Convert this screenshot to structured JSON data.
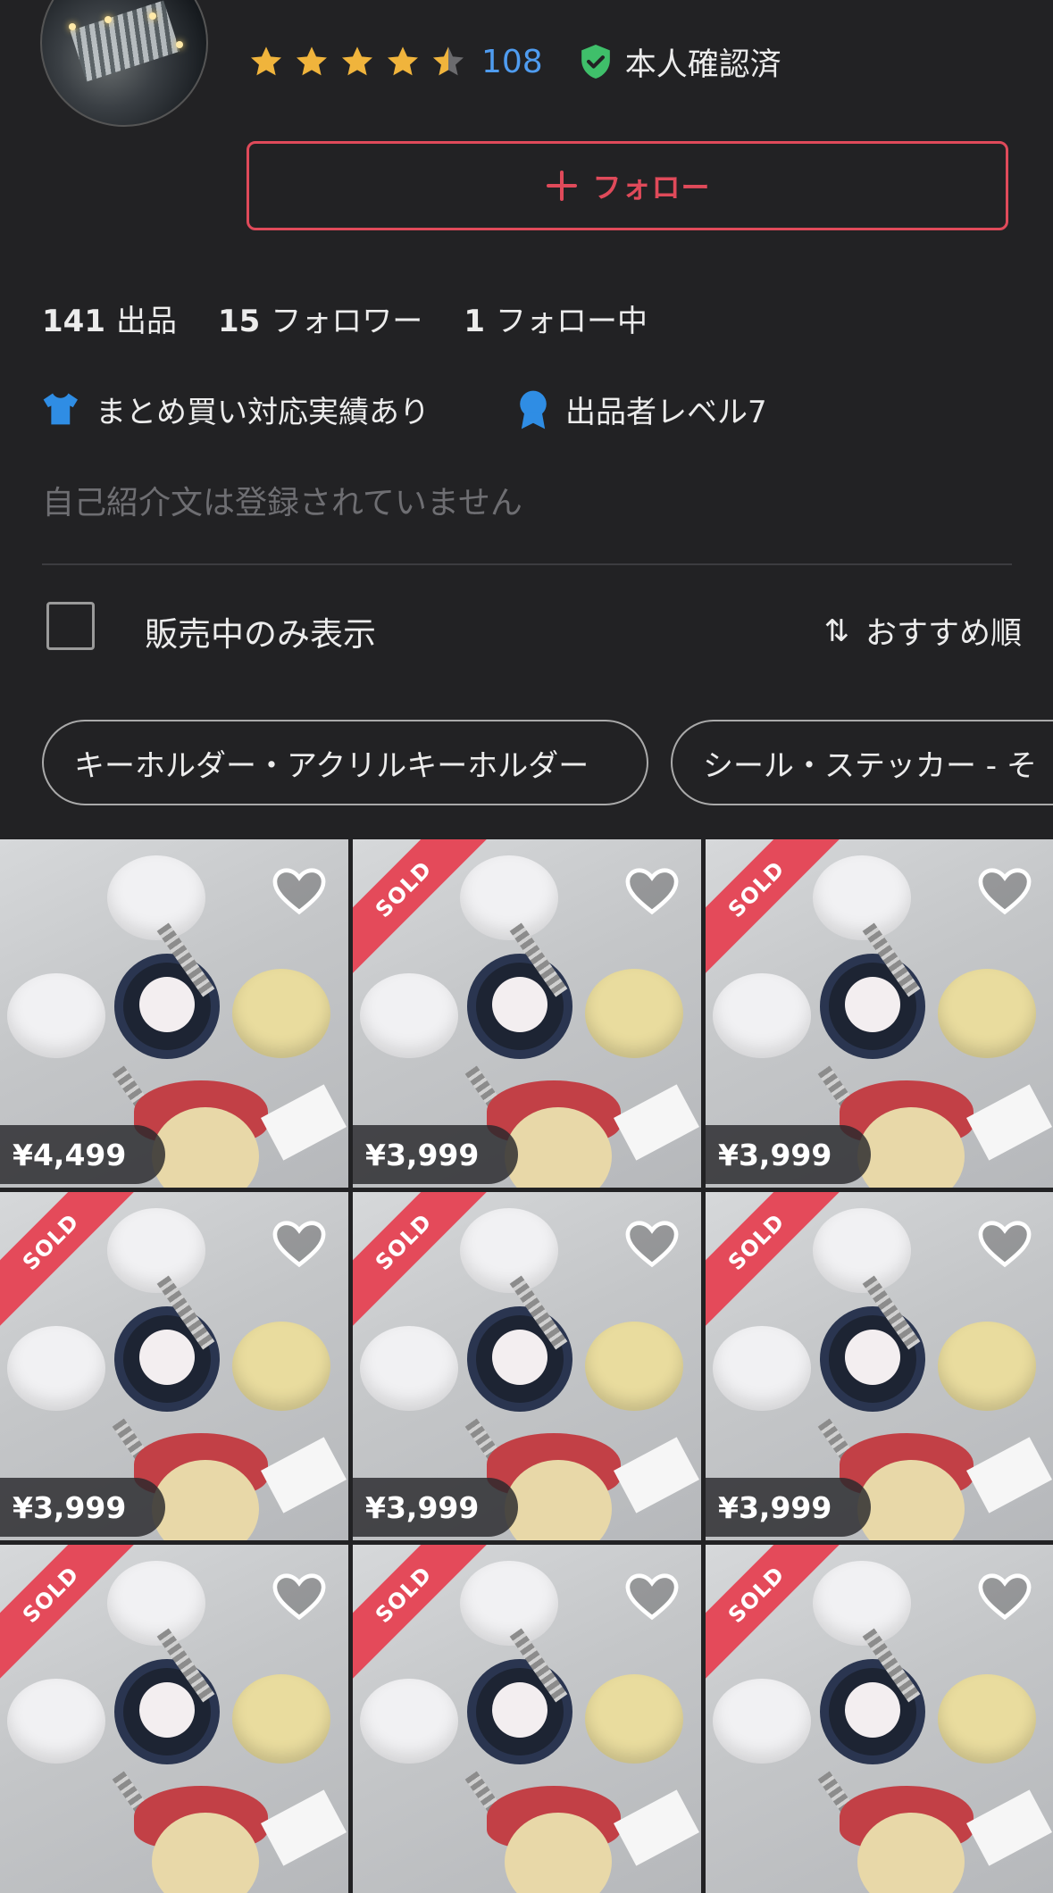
{
  "profile": {
    "rating_count": "108",
    "rating_stars": 4.5,
    "verified_label": "本人確認済",
    "follow_label": "フォロー"
  },
  "stats": [
    {
      "num": "141",
      "label": "出品"
    },
    {
      "num": "15",
      "label": "フォロワー"
    },
    {
      "num": "1",
      "label": "フォロー中"
    }
  ],
  "badges": {
    "bulk": "まとめ買い対応実績あり",
    "level": "出品者レベル7"
  },
  "bio": "自己紹介文は登録されていません",
  "filter": {
    "on_sale_only": "販売中のみ表示",
    "checked": false,
    "sort_label": "おすすめ順"
  },
  "categories": [
    "キーホルダー・アクリルキーホルダー",
    "シール・ステッカー - そ"
  ],
  "items": [
    {
      "price": "¥4,499",
      "sold": false
    },
    {
      "price": "¥3,999",
      "sold": true
    },
    {
      "price": "¥3,999",
      "sold": true
    },
    {
      "price": "¥3,999",
      "sold": true
    },
    {
      "price": "¥3,999",
      "sold": true
    },
    {
      "price": "¥3,999",
      "sold": true
    },
    {
      "price": "",
      "sold": true
    },
    {
      "price": "",
      "sold": true
    },
    {
      "price": "",
      "sold": true
    }
  ],
  "sold_label": "SOLD",
  "colors": {
    "background": "#222224",
    "accent": "#e04a5a",
    "link": "#4f9cf0",
    "star": "#f0b43c",
    "verified": "#3fbf6a",
    "badge": "#2f8de4"
  }
}
